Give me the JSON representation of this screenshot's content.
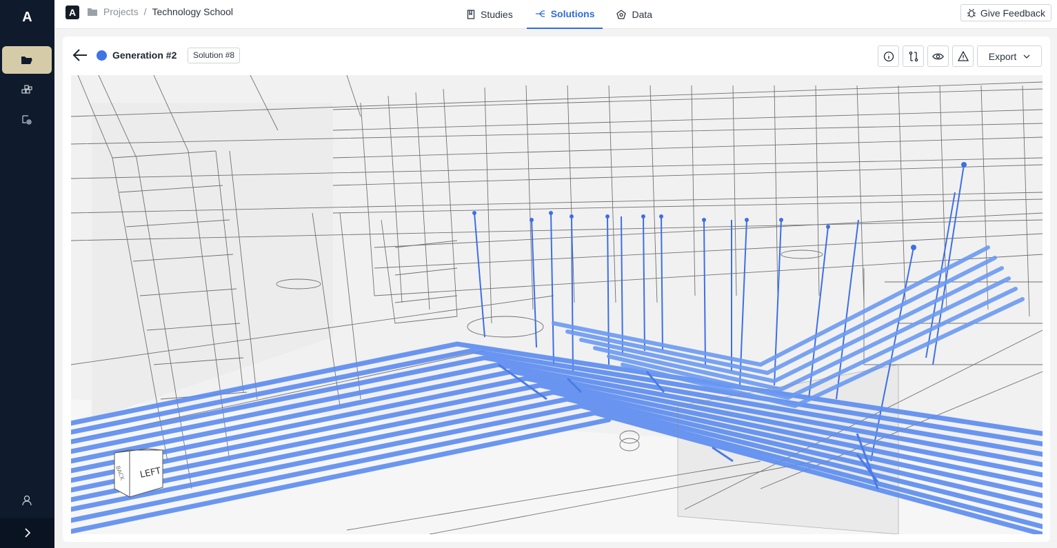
{
  "sidebar": {
    "logo": "A",
    "items": [
      {
        "icon": "folder-open-icon",
        "active": true
      },
      {
        "icon": "blocks-icon",
        "active": false
      },
      {
        "icon": "route-settings-icon",
        "active": false
      }
    ],
    "bottom_items": [
      {
        "icon": "user-icon"
      },
      {
        "icon": "chevron-right-icon"
      }
    ]
  },
  "topbar": {
    "logo": "A",
    "breadcrumb": {
      "root": "Projects",
      "separator": "/",
      "current": "Technology School"
    },
    "tabs": [
      {
        "label": "Studies",
        "icon": "book-icon",
        "active": false
      },
      {
        "label": "Solutions",
        "icon": "branch-icon",
        "active": true
      },
      {
        "label": "Data",
        "icon": "pentagon-icon",
        "active": false
      }
    ],
    "feedback_label": "Give Feedback"
  },
  "header": {
    "generation_title": "Generation #2",
    "generation_color": "#3f73e8",
    "solution_badge": "Solution #8",
    "tools": [
      "info-icon",
      "compare-icon",
      "eye-icon",
      "warning-icon"
    ],
    "export_label": "Export"
  },
  "viewport": {
    "navcube": {
      "front": "LEFT",
      "side": "BACK"
    },
    "pipe_color": "#5b8cf0"
  }
}
